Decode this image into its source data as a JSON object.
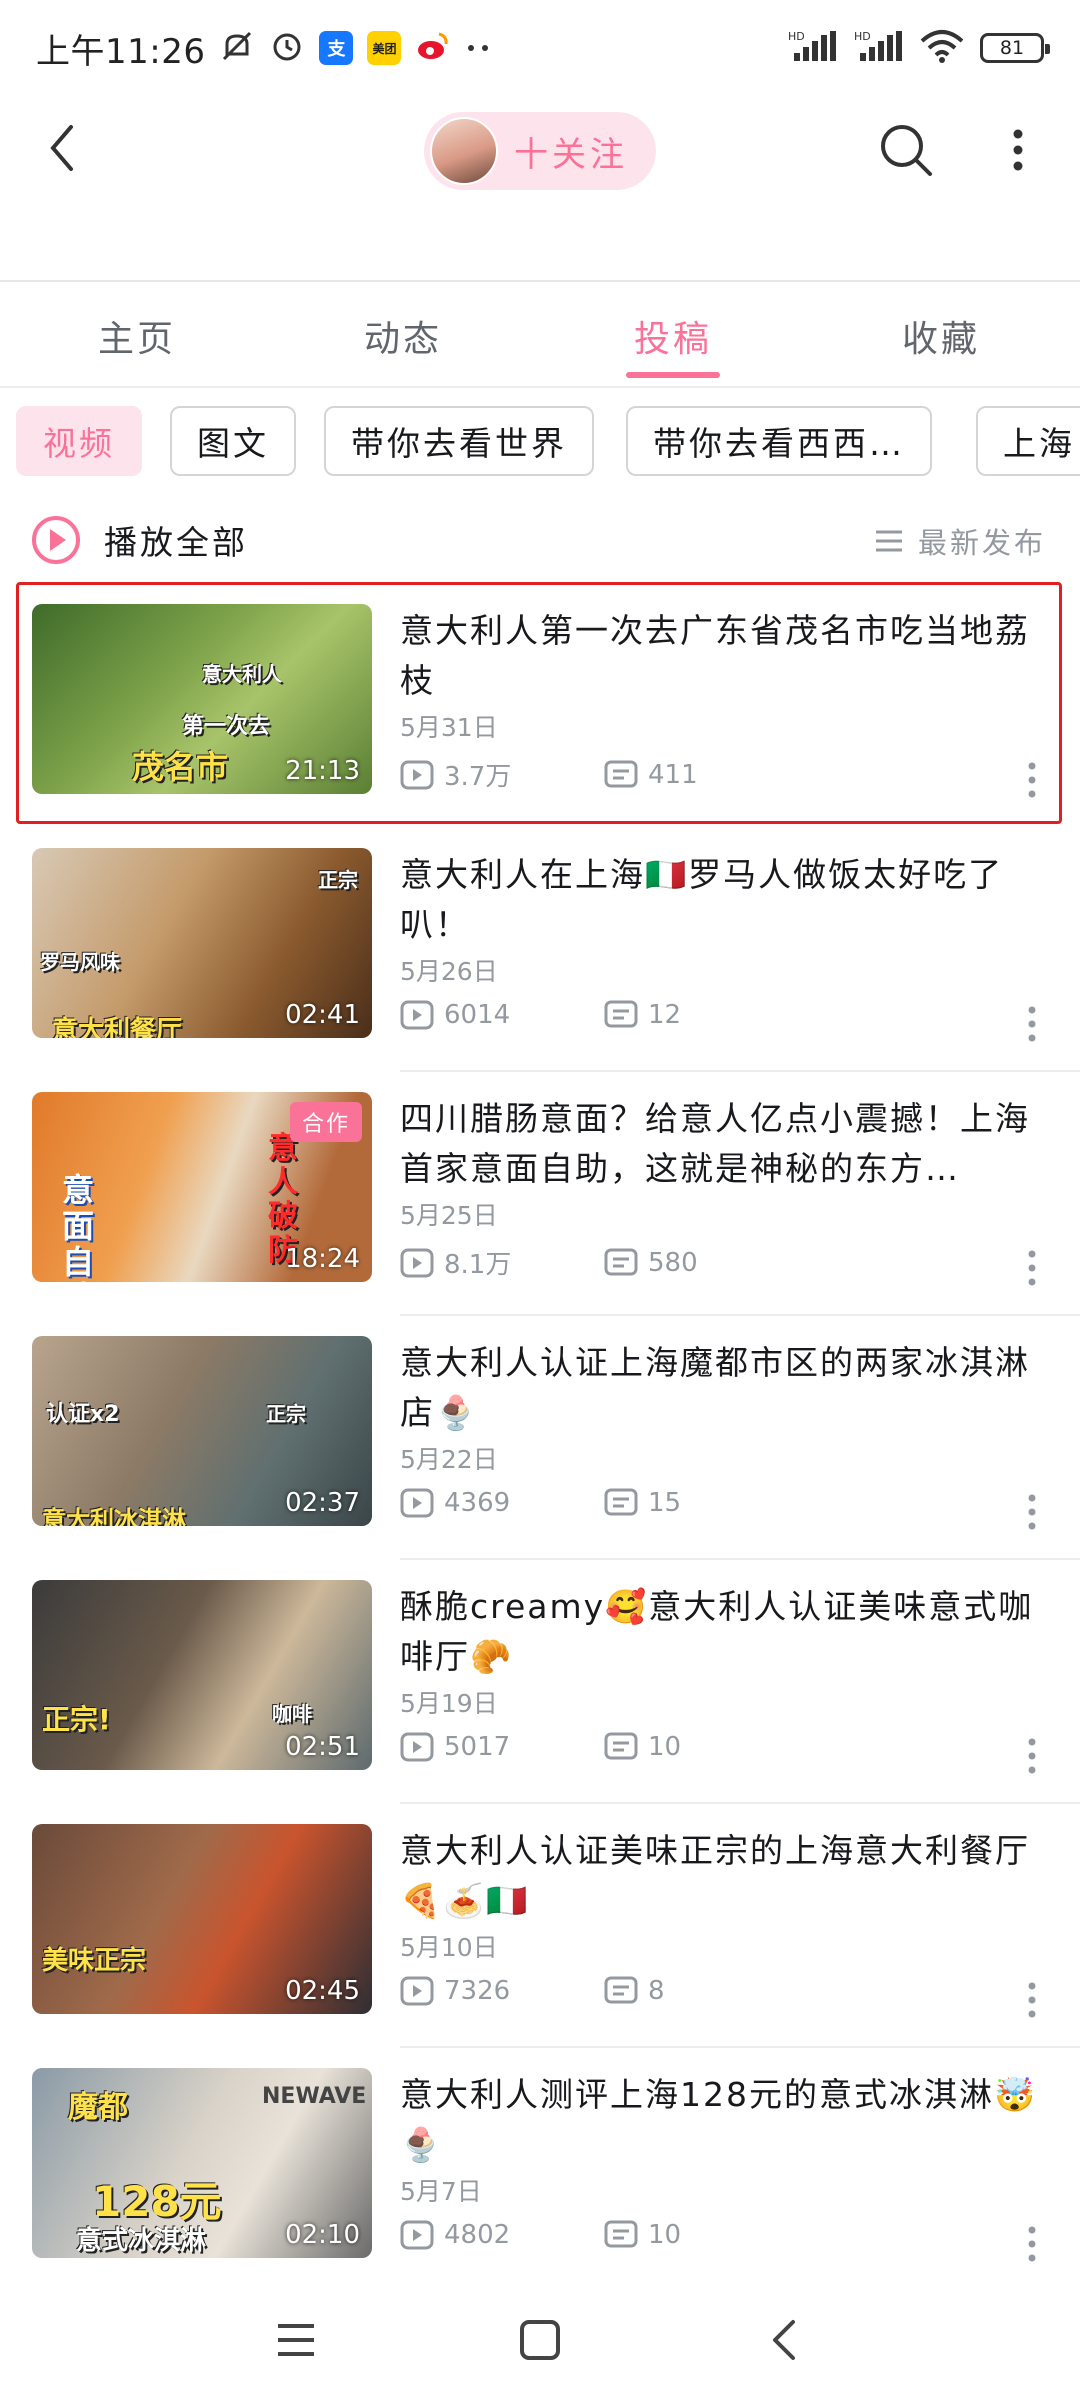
{
  "status_bar": {
    "time": "上午11:26",
    "icons_left": [
      "mute-icon",
      "alarm-icon",
      "alipay-icon",
      "meituan-icon",
      "weibo-icon",
      "more-dots-icon"
    ],
    "app_alipay": "支",
    "app_meituan": "美团",
    "network_left": "HD",
    "network_right": "HD",
    "battery": "81"
  },
  "header": {
    "follow_label": "十关注"
  },
  "tabs": [
    {
      "label": "主页",
      "active": false
    },
    {
      "label": "动态",
      "active": false
    },
    {
      "label": "投稿",
      "active": true
    },
    {
      "label": "收藏",
      "active": false
    }
  ],
  "chips": [
    {
      "label": "视频",
      "active": true
    },
    {
      "label": "图文",
      "active": false
    },
    {
      "label": "带你去看世界",
      "active": false
    },
    {
      "label": "带你去看西西…",
      "active": false
    },
    {
      "label": "上海",
      "active": false
    }
  ],
  "list_header": {
    "play_all": "播放全部",
    "sort": "最新发布"
  },
  "videos": [
    {
      "title": "意大利人第一次去广东省茂名市吃当地荔枝",
      "date": "5月31日",
      "views": "3.7万",
      "comments": "411",
      "duration": "21:13",
      "thumb_text": [
        "意大利人",
        "第一次去",
        "茂名市"
      ],
      "badge": "",
      "selected": true
    },
    {
      "title": "意大利人在上海🇮🇹罗马人做饭太好吃了叭！",
      "date": "5月26日",
      "views": "6014",
      "comments": "12",
      "duration": "02:41",
      "thumb_text": [
        "罗马风味",
        "正宗",
        "意大利餐厅"
      ],
      "badge": "",
      "selected": false
    },
    {
      "title": "四川腊肠意面？给意人亿点小震撼！上海首家意面自助，这就是神秘的东方…",
      "date": "5月25日",
      "views": "8.1万",
      "comments": "580",
      "duration": "18:24",
      "thumb_text": [
        "意面自助",
        "意人破防"
      ],
      "badge": "合作",
      "selected": false
    },
    {
      "title": "意大利人认证上海魔都市区的两家冰淇淋店🍨",
      "date": "5月22日",
      "views": "4369",
      "comments": "15",
      "duration": "02:37",
      "thumb_text": [
        "认证x2",
        "正宗",
        "意大利冰淇淋"
      ],
      "badge": "",
      "selected": false
    },
    {
      "title": "酥脆creamy🥰意大利人认证美味意式咖啡厅🥐",
      "date": "5月19日",
      "views": "5017",
      "comments": "10",
      "duration": "02:51",
      "thumb_text": [
        "正宗!",
        "咖啡"
      ],
      "badge": "",
      "selected": false
    },
    {
      "title": "意大利人认证美味正宗的上海意大利餐厅🍕🍝🇮🇹",
      "date": "5月10日",
      "views": "7326",
      "comments": "8",
      "duration": "02:45",
      "thumb_text": [
        "美味正宗"
      ],
      "badge": "",
      "selected": false
    },
    {
      "title": "意大利人测评上海128元的意式冰淇淋🤯🍨",
      "date": "5月7日",
      "views": "4802",
      "comments": "10",
      "duration": "02:10",
      "thumb_text": [
        "魔都",
        "128元",
        "意式冰淇淋",
        "NEWAVE"
      ],
      "badge": "",
      "selected": false
    }
  ],
  "colors": {
    "accent": "#fb7299",
    "accent_bg": "#fde4ec",
    "text_primary": "#18191c",
    "text_secondary": "#9499a0",
    "highlight": "#e02020"
  }
}
